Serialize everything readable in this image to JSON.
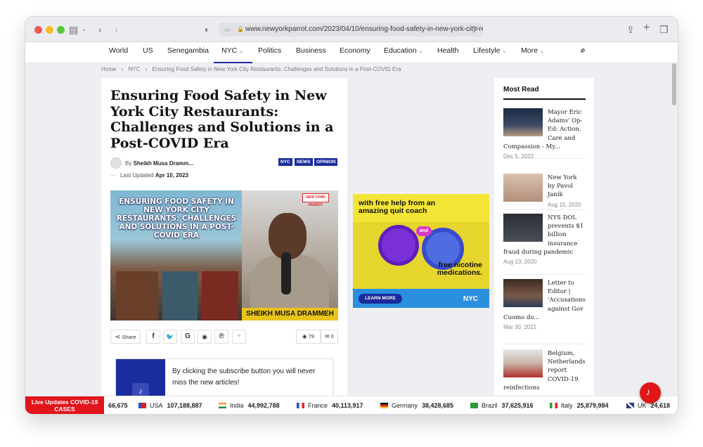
{
  "browser": {
    "url": "www.newyorkparrot.com/2023/04/10/ensuring-food-safety-in-new-york-city-re",
    "traffic_lights": [
      "#ee5c55",
      "#f5bd2e",
      "#5bc63f"
    ]
  },
  "nav": {
    "items": [
      {
        "label": "World"
      },
      {
        "label": "US"
      },
      {
        "label": "Senegambia"
      },
      {
        "label": "NYC"
      },
      {
        "label": "Politics"
      },
      {
        "label": "Business"
      },
      {
        "label": "Economy"
      },
      {
        "label": "Education"
      },
      {
        "label": "Health"
      },
      {
        "label": "Lifestyle"
      },
      {
        "label": "More"
      }
    ],
    "active": "NYC",
    "accent": "#1d2b9c"
  },
  "breadcrumb": {
    "home": "Home",
    "section": "NYC",
    "current": "Ensuring Food Safety in New York City Restaurants: Challenges and Solutions in a Post-COVID Era"
  },
  "article": {
    "title": "Ensuring Food Safety in New York City Restaurants: Challenges and Solutions in a Post-COVID Era",
    "by_label": "By",
    "author": "Sheikh Musa Dramm...",
    "updated_label": "Last Updated",
    "updated_date": "Apr 10, 2023",
    "tags": [
      "NYC",
      "NEWS",
      "OPINION"
    ],
    "hero": {
      "headline": "ENSURING FOOD SAFETY IN NEW YORK CITY RESTAURANTS: CHALLENGES AND SOLUTIONS IN A POST-COVID ERA",
      "name_banner": "SHEIKH MUSA DRAMMEH",
      "logo": "NEW YORK PARROT"
    },
    "share_label": "Share",
    "views": "79",
    "comments": "0",
    "subscribe_text": "By clicking the subscribe button you will never miss the new articles!"
  },
  "ad": {
    "headline": "with free help from an amazing quit coach",
    "and_label": "and",
    "tagline": "free nicotine medications.",
    "cta": "LEARN MORE",
    "brand": "NYC"
  },
  "most_read": {
    "title": "Most Read",
    "items": [
      {
        "title": "Mayor Eric Adams' Op-Ed: Action, Care and Compassion - My...",
        "date": "Dec 5, 2022"
      },
      {
        "title": "New York by Pavol Janik",
        "date": "Aug 15, 2020"
      },
      {
        "title": "NYS DOL prevents $1 billion insurance fraud during pandemic",
        "date": "Aug 13, 2020"
      },
      {
        "title": "Letter to Editor | 'Accusations against Gov Cuomo do...",
        "date": "Mar 30, 2021"
      },
      {
        "title": "Belgium, Netherlands report COVID-19 reinfections",
        "date": ""
      }
    ]
  },
  "ticker": {
    "label": "Live Updates COVID-19 CASES",
    "leading_value": "66,675",
    "countries": [
      {
        "name": "USA",
        "value": "107,188,887"
      },
      {
        "name": "India",
        "value": "44,992,788"
      },
      {
        "name": "France",
        "value": "40,113,917"
      },
      {
        "name": "Germany",
        "value": "38,428,685"
      },
      {
        "name": "Brazil",
        "value": "37,625,916"
      },
      {
        "name": "Italy",
        "value": "25,879,984"
      },
      {
        "name": "UK",
        "value": "24,618"
      }
    ]
  }
}
